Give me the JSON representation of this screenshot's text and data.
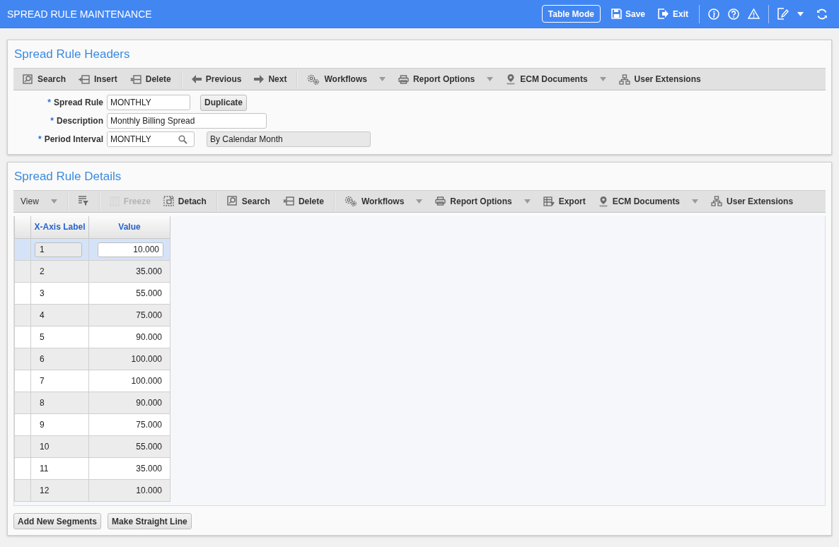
{
  "window": {
    "title": "SPREAD RULE MAINTENANCE"
  },
  "header_buttons": [
    {
      "label": "Table Mode",
      "kind": "outlined"
    },
    {
      "label": "Save",
      "kind": "plain"
    },
    {
      "label": "Exit",
      "kind": "plain"
    }
  ],
  "headers_panel": {
    "title": "Spread Rule Headers",
    "toolbar": [
      [
        {
          "label": "Search",
          "dropdown": false,
          "disabled": false
        },
        {
          "label": "Insert",
          "dropdown": false,
          "disabled": false
        },
        {
          "label": "Delete",
          "dropdown": false,
          "disabled": false
        }
      ],
      [
        {
          "label": "Previous",
          "dropdown": false,
          "disabled": false
        },
        {
          "label": "Next",
          "dropdown": false,
          "disabled": false
        }
      ],
      [
        {
          "label": "Workflows",
          "dropdown": true,
          "disabled": false
        },
        {
          "label": "Report Options",
          "dropdown": true,
          "disabled": false
        },
        {
          "label": "ECM Documents",
          "dropdown": true,
          "disabled": false
        },
        {
          "label": "User Extensions",
          "dropdown": false,
          "disabled": false
        }
      ]
    ],
    "fields": [
      {
        "required_mark": "*",
        "label": "Spread Rule",
        "value": "MONTHLY",
        "kind": "text",
        "button": "Duplicate"
      },
      {
        "required_mark": "*",
        "label": "Description",
        "value": "Monthly Billing Spread",
        "kind": "wide"
      },
      {
        "required_mark": "*",
        "label": "Period Interval",
        "value": "MONTHLY",
        "kind": "lookup",
        "description": "By Calendar Month"
      }
    ]
  },
  "details_panel": {
    "title": "Spread Rule Details",
    "toolbar": [
      [
        {
          "label": "View",
          "dropdown": true,
          "disabled": false
        }
      ],
      [
        {
          "dropdown": false,
          "disabled": false
        }
      ],
      [
        {
          "label": "Freeze",
          "dropdown": false,
          "disabled": true
        },
        {
          "label": "Detach",
          "dropdown": false,
          "disabled": false
        }
      ],
      [
        {
          "label": "Search",
          "dropdown": false,
          "disabled": false
        },
        {
          "label": "Delete",
          "dropdown": false,
          "disabled": false
        }
      ],
      [
        {
          "label": "Workflows",
          "dropdown": true,
          "disabled": false
        },
        {
          "label": "Report Options",
          "dropdown": true,
          "disabled": false
        },
        {
          "label": "Export",
          "dropdown": false,
          "disabled": false
        },
        {
          "label": "ECM Documents",
          "dropdown": true,
          "disabled": false
        },
        {
          "label": "User Extensions",
          "dropdown": false,
          "disabled": false
        }
      ]
    ],
    "table": {
      "columns": [
        "X-Axis Label",
        "Value"
      ],
      "rows": [
        {
          "label": "1",
          "value": "10.000",
          "selected": true
        },
        {
          "label": "2",
          "value": "35.000",
          "selected": false
        },
        {
          "label": "3",
          "value": "55.000",
          "selected": false
        },
        {
          "label": "4",
          "value": "75.000",
          "selected": false
        },
        {
          "label": "5",
          "value": "90.000",
          "selected": false
        },
        {
          "label": "6",
          "value": "100.000",
          "selected": false
        },
        {
          "label": "7",
          "value": "100.000",
          "selected": false
        },
        {
          "label": "8",
          "value": "90.000",
          "selected": false
        },
        {
          "label": "9",
          "value": "75.000",
          "selected": false
        },
        {
          "label": "10",
          "value": "55.000",
          "selected": false
        },
        {
          "label": "11",
          "value": "35.000",
          "selected": false
        },
        {
          "label": "12",
          "value": "10.000",
          "selected": false
        }
      ]
    },
    "buttons": [
      "Add New Segments",
      "Make Straight Line"
    ]
  }
}
